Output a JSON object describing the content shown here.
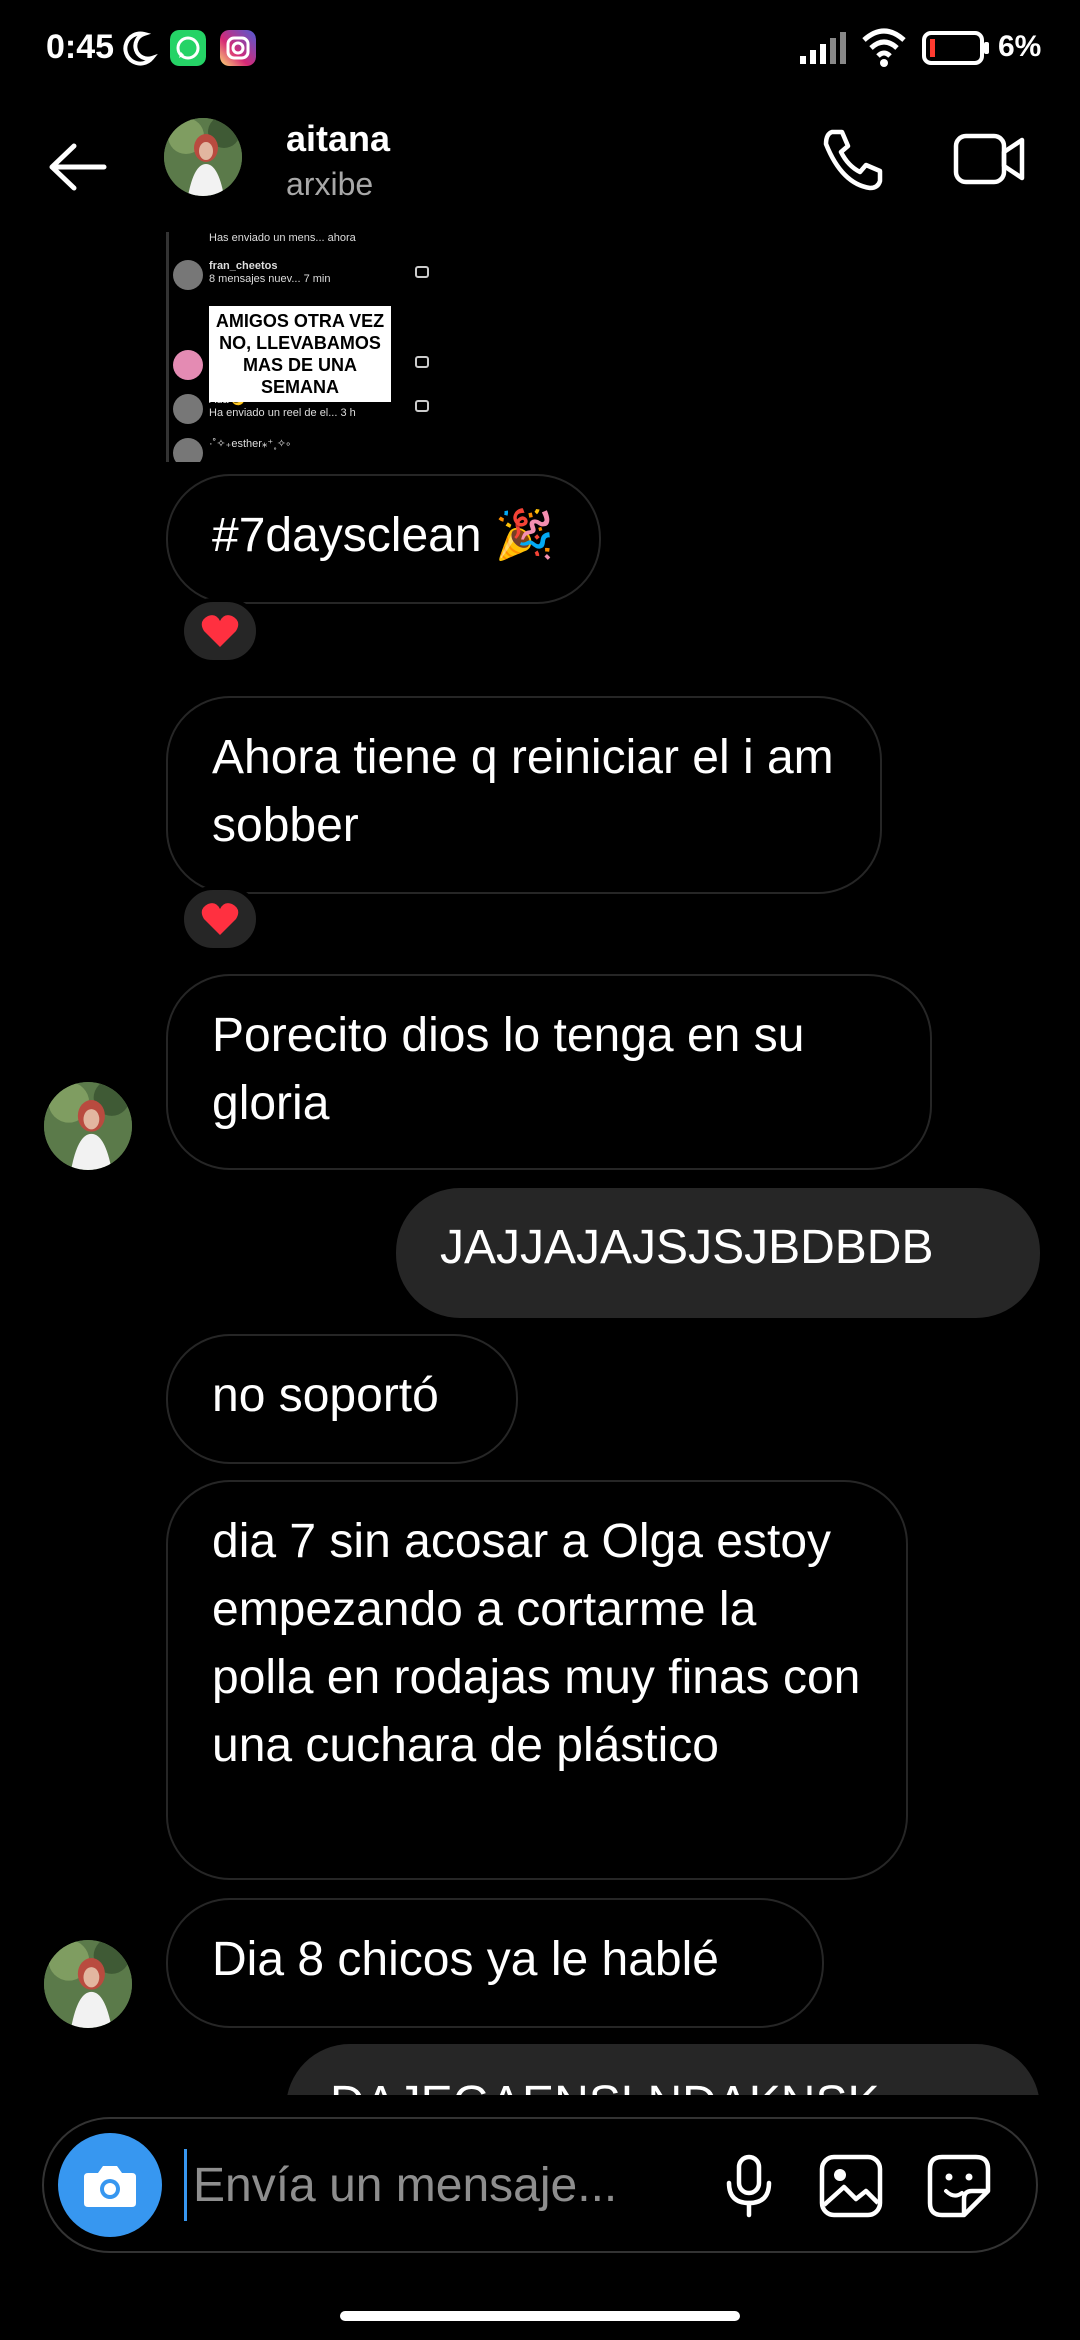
{
  "status_bar": {
    "time": "0:45",
    "battery": "6%",
    "icons": [
      "moon-icon",
      "whatsapp-icon",
      "instagram-icon",
      "signal-icon",
      "wifi-icon",
      "battery-icon"
    ]
  },
  "header": {
    "name": "aitana",
    "handle": "arxibe",
    "icons": [
      "back-arrow-icon",
      "phone-icon",
      "video-camera-icon"
    ]
  },
  "shared_post": {
    "rows": [
      {
        "name": "Has enviado un mens... ahora",
        "sub": ""
      },
      {
        "name": "fran_cheetos",
        "sub": "8 mensajes nuev... 7 min"
      },
      {
        "name": "",
        "sub": ""
      },
      {
        "name": "Ada 🌙",
        "sub": "Ha enviado un reel de el... 3 h"
      },
      {
        "name": "·˚✧₊esther⁎⁺˳✧༚",
        "sub": ""
      }
    ],
    "overlay_text": "AMIGOS OTRA VEZ NO, LLEVABAMOS MAS DE UNA SEMANA"
  },
  "messages": [
    {
      "text": "#7daysclean 🎉",
      "reaction": "❤️"
    },
    {
      "text": "Ahora tiene q reiniciar el i am sobber",
      "reaction": "❤️"
    },
    {
      "text": "Porecito dios lo tenga en su gloria"
    },
    {
      "text": "JAJJAJAJSJSJBDBDB"
    },
    {
      "text": "no soportó"
    },
    {
      "text": "dia 7 sin acosar a Olga estoy empezando a cortarme la polla en rodajas muy finas con una cuchara de plástico"
    },
    {
      "text": "Dia 8 chicos ya le hablé"
    },
    {
      "text": "DAJEGAENSLNDAKNSK"
    }
  ],
  "composer": {
    "placeholder": "Envía un mensaje...",
    "icons": [
      "camera-icon",
      "microphone-icon",
      "gallery-icon",
      "sticker-icon"
    ]
  },
  "colors": {
    "background": "#000000",
    "incoming_border": "#262626",
    "outgoing_bubble": "#262626",
    "accent": "#3797f0",
    "secondary_text": "#a8a8a8"
  }
}
